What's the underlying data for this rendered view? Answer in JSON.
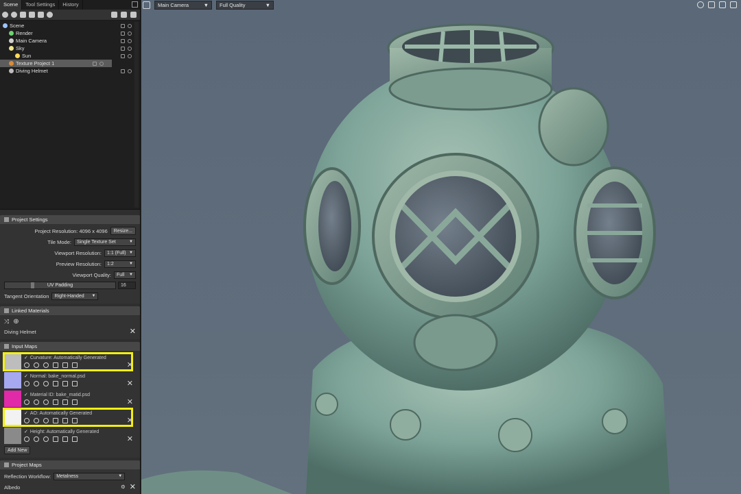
{
  "left_tabs": [
    "Scene",
    "Tool Settings",
    "History"
  ],
  "scene_tree": [
    {
      "label": "Scene",
      "indent": 0,
      "icon": "scene-icon",
      "color": "#9ec3ff"
    },
    {
      "label": "Render",
      "indent": 1,
      "icon": "render-icon",
      "color": "#6fd36f"
    },
    {
      "label": "Main Camera",
      "indent": 1,
      "icon": "camera-icon",
      "color": "#cfcfcf"
    },
    {
      "label": "Sky",
      "indent": 1,
      "icon": "sky-icon",
      "color": "#f0e68c"
    },
    {
      "label": "Sun",
      "indent": 2,
      "icon": "sun-icon",
      "color": "#ffd95a"
    },
    {
      "label": "Texture Project 1",
      "indent": 1,
      "icon": "texture-project-icon",
      "color": "#d98c3a",
      "selected": true
    },
    {
      "label": "Diving Helmet",
      "indent": 1,
      "icon": "mesh-icon",
      "color": "#bdbdbd"
    }
  ],
  "project_settings": {
    "title": "Project Settings",
    "resolution_label": "Project Resolution: 4096 x 4096",
    "resize_label": "Resize...",
    "tile_mode_label": "Tile Mode:",
    "tile_mode_value": "Single Texture Set",
    "viewport_res_label": "Viewport Resolution:",
    "viewport_res_value": "1:1 (Full)",
    "preview_res_label": "Preview Resolution:",
    "preview_res_value": "1:2",
    "viewport_quality_label": "Viewport Quality:",
    "viewport_quality_value": "Full",
    "uv_padding_label": "UV Padding",
    "uv_padding_value": "16",
    "tangent_label": "Tangent Orientation",
    "tangent_value": "Right-Handed"
  },
  "linked_materials": {
    "title": "Linked Materials",
    "items": [
      "Diving Helmet"
    ]
  },
  "input_maps": {
    "title": "Input Maps",
    "items": [
      {
        "name": "Curvature: Automatically Generated",
        "thumb": "#bdbdbd",
        "highlighted": true
      },
      {
        "name": "Normal: bake_normal.psd",
        "thumb": "#a6a8f0",
        "highlighted": false
      },
      {
        "name": "Material ID: bake_matid.psd",
        "thumb": "#e02aa8",
        "highlighted": false
      },
      {
        "name": "AO: Automatically Generated",
        "thumb": "#f2f2f2",
        "highlighted": true
      },
      {
        "name": "Height: Automatically Generated",
        "thumb": "#8a8a8a",
        "highlighted": false
      }
    ],
    "add_new_label": "Add New"
  },
  "project_maps": {
    "title": "Project Maps",
    "workflow_label": "Reflection Workflow:",
    "workflow_value": "Metalness",
    "albedo_label": "Albedo"
  },
  "viewport": {
    "camera_value": "Main Camera",
    "quality_value": "Full Quality"
  },
  "colors": {
    "highlight": "#f2ef12",
    "helmet_patina": "#7da398",
    "background": "#5e6c7b"
  }
}
